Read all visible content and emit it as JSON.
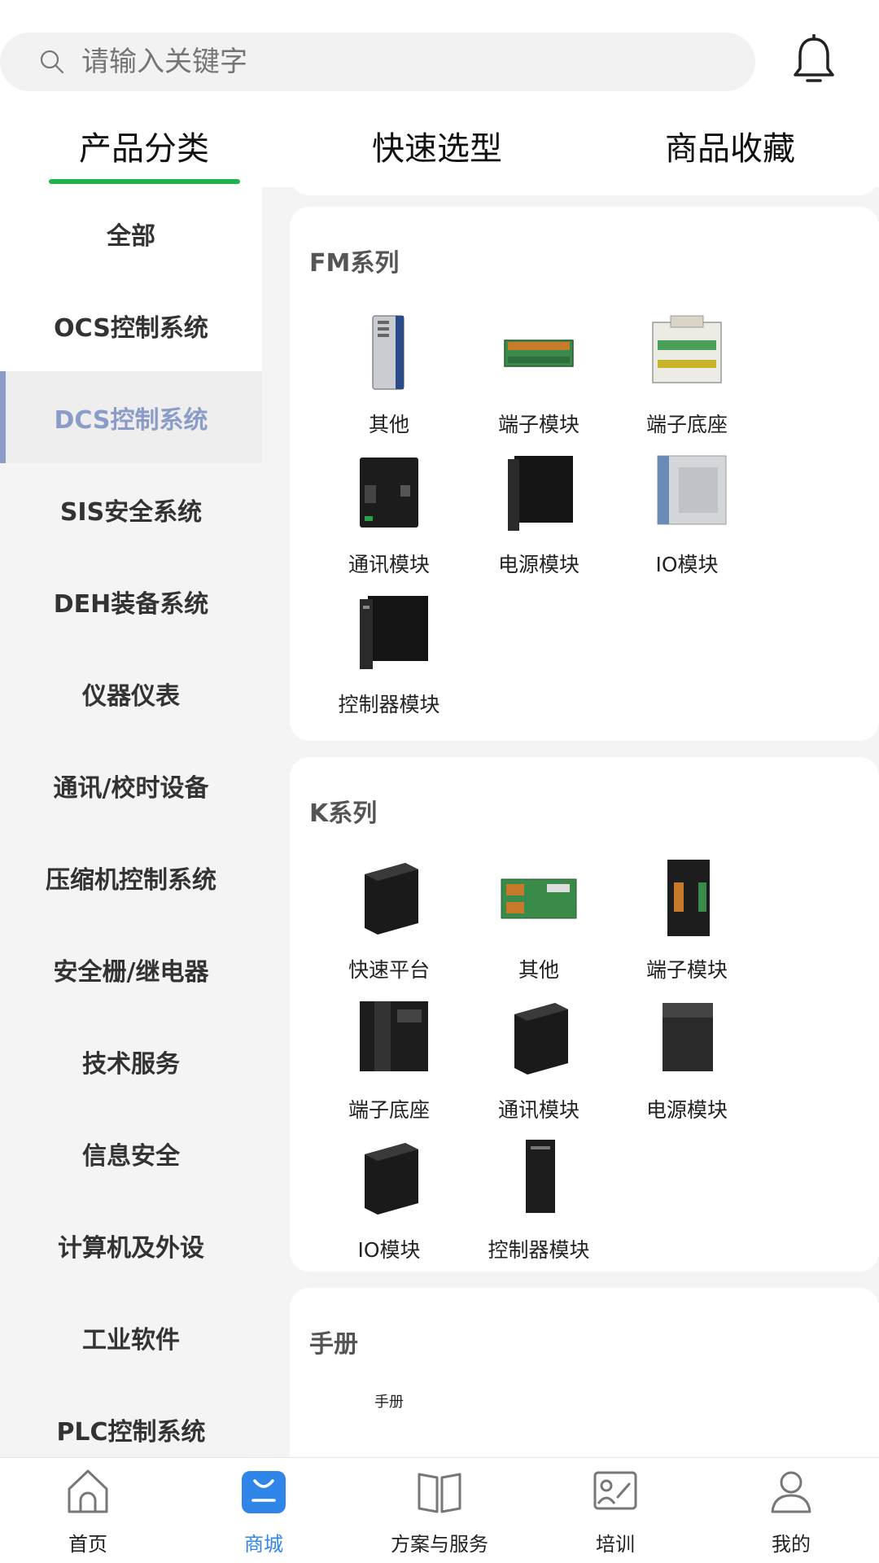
{
  "search": {
    "placeholder": "请输入关键字"
  },
  "tabs": [
    {
      "label": "产品分类"
    },
    {
      "label": "快速选型"
    },
    {
      "label": "商品收藏"
    }
  ],
  "sidebar": {
    "items": [
      {
        "label": "全部"
      },
      {
        "label": "OCS控制系统"
      },
      {
        "label": "DCS控制系统"
      },
      {
        "label": "SIS安全系统"
      },
      {
        "label": "DEH装备系统"
      },
      {
        "label": "仪器仪表"
      },
      {
        "label": "通讯/校时设备"
      },
      {
        "label": "压缩机控制系统"
      },
      {
        "label": "安全栅/继电器"
      },
      {
        "label": "技术服务"
      },
      {
        "label": "信息安全"
      },
      {
        "label": "计算机及外设"
      },
      {
        "label": "工业软件"
      },
      {
        "label": "PLC控制系统"
      }
    ],
    "active_index": 2
  },
  "sections": [
    {
      "title": "FM系列",
      "items": [
        {
          "label": "其他",
          "icon": "gray-module-image"
        },
        {
          "label": "端子模块",
          "icon": "green-terminal-board-image"
        },
        {
          "label": "端子底座",
          "icon": "terminal-base-image"
        },
        {
          "label": "通讯模块",
          "icon": "black-comm-module-image"
        },
        {
          "label": "电源模块",
          "icon": "black-power-module-image"
        },
        {
          "label": "IO模块",
          "icon": "gray-io-module-image"
        },
        {
          "label": "控制器模块",
          "icon": "black-controller-module-image"
        }
      ]
    },
    {
      "title": "K系列",
      "items": [
        {
          "label": "快速平台",
          "icon": "black-module-image"
        },
        {
          "label": "其他",
          "icon": "green-board-image"
        },
        {
          "label": "端子模块",
          "icon": "black-terminal-module-image"
        },
        {
          "label": "端子底座",
          "icon": "black-terminal-base-image"
        },
        {
          "label": "通讯模块",
          "icon": "black-comm-module-image"
        },
        {
          "label": "电源模块",
          "icon": "black-power-module-image"
        },
        {
          "label": "IO模块",
          "icon": "black-io-module-image"
        },
        {
          "label": "控制器模块",
          "icon": "black-controller-module-image"
        }
      ]
    },
    {
      "title": "手册",
      "items": [
        {
          "label": "手册",
          "icon": "manual-image"
        }
      ]
    }
  ],
  "bottom_nav": [
    {
      "label": "首页",
      "icon": "home-icon"
    },
    {
      "label": "商城",
      "icon": "mall-icon",
      "active": true
    },
    {
      "label": "方案与服务",
      "icon": "book-icon"
    },
    {
      "label": "培训",
      "icon": "training-icon"
    },
    {
      "label": "我的",
      "icon": "user-icon"
    }
  ],
  "colors": {
    "accent_green": "#22b24c",
    "active_side": "#8c9cc8",
    "active_nav": "#2f86e8"
  }
}
